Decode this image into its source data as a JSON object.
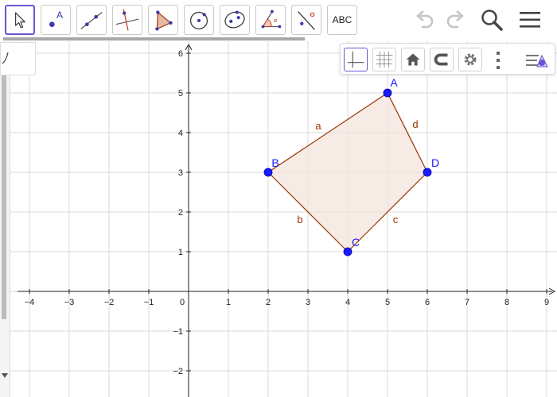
{
  "toolbar": {
    "tools": [
      {
        "name": "move"
      },
      {
        "name": "point",
        "label": "A"
      },
      {
        "name": "line"
      },
      {
        "name": "perpendicular-line"
      },
      {
        "name": "polygon"
      },
      {
        "name": "circle-center-point"
      },
      {
        "name": "ellipse"
      },
      {
        "name": "angle"
      },
      {
        "name": "reflect-about-line"
      },
      {
        "name": "text",
        "label": "ABC"
      }
    ],
    "icons": [
      "undo-icon",
      "redo-icon",
      "search-icon",
      "menu-icon"
    ]
  },
  "style_bar": {
    "buttons": [
      "axes-toggle",
      "grid-toggle",
      "home-view",
      "point-capture",
      "settings",
      "more-options",
      "algebra-toggle"
    ]
  },
  "graphics": {
    "x_ticks": [
      "−4",
      "−3",
      "−2",
      "−1",
      "0",
      "1",
      "2",
      "3",
      "4",
      "5",
      "6",
      "7",
      "8",
      "9"
    ],
    "y_ticks": [
      "6",
      "5",
      "4",
      "3",
      "2",
      "1",
      "−1",
      "−2"
    ],
    "points": [
      {
        "label": "A",
        "x": 5,
        "y": 5
      },
      {
        "label": "B",
        "x": 2,
        "y": 3
      },
      {
        "label": "C",
        "x": 4,
        "y": 1
      },
      {
        "label": "D",
        "x": 6,
        "y": 3
      }
    ],
    "segments": [
      {
        "label": "a",
        "from": "B",
        "to": "A"
      },
      {
        "label": "b",
        "from": "B",
        "to": "C"
      },
      {
        "label": "c",
        "from": "C",
        "to": "D"
      },
      {
        "label": "d",
        "from": "A",
        "to": "D"
      }
    ],
    "colors": {
      "point": "#1a1aff",
      "segment": "#993300",
      "polygon_fill": "#f3e4dc",
      "grid": "#d9d9d9",
      "accent": "#6557d2"
    }
  }
}
